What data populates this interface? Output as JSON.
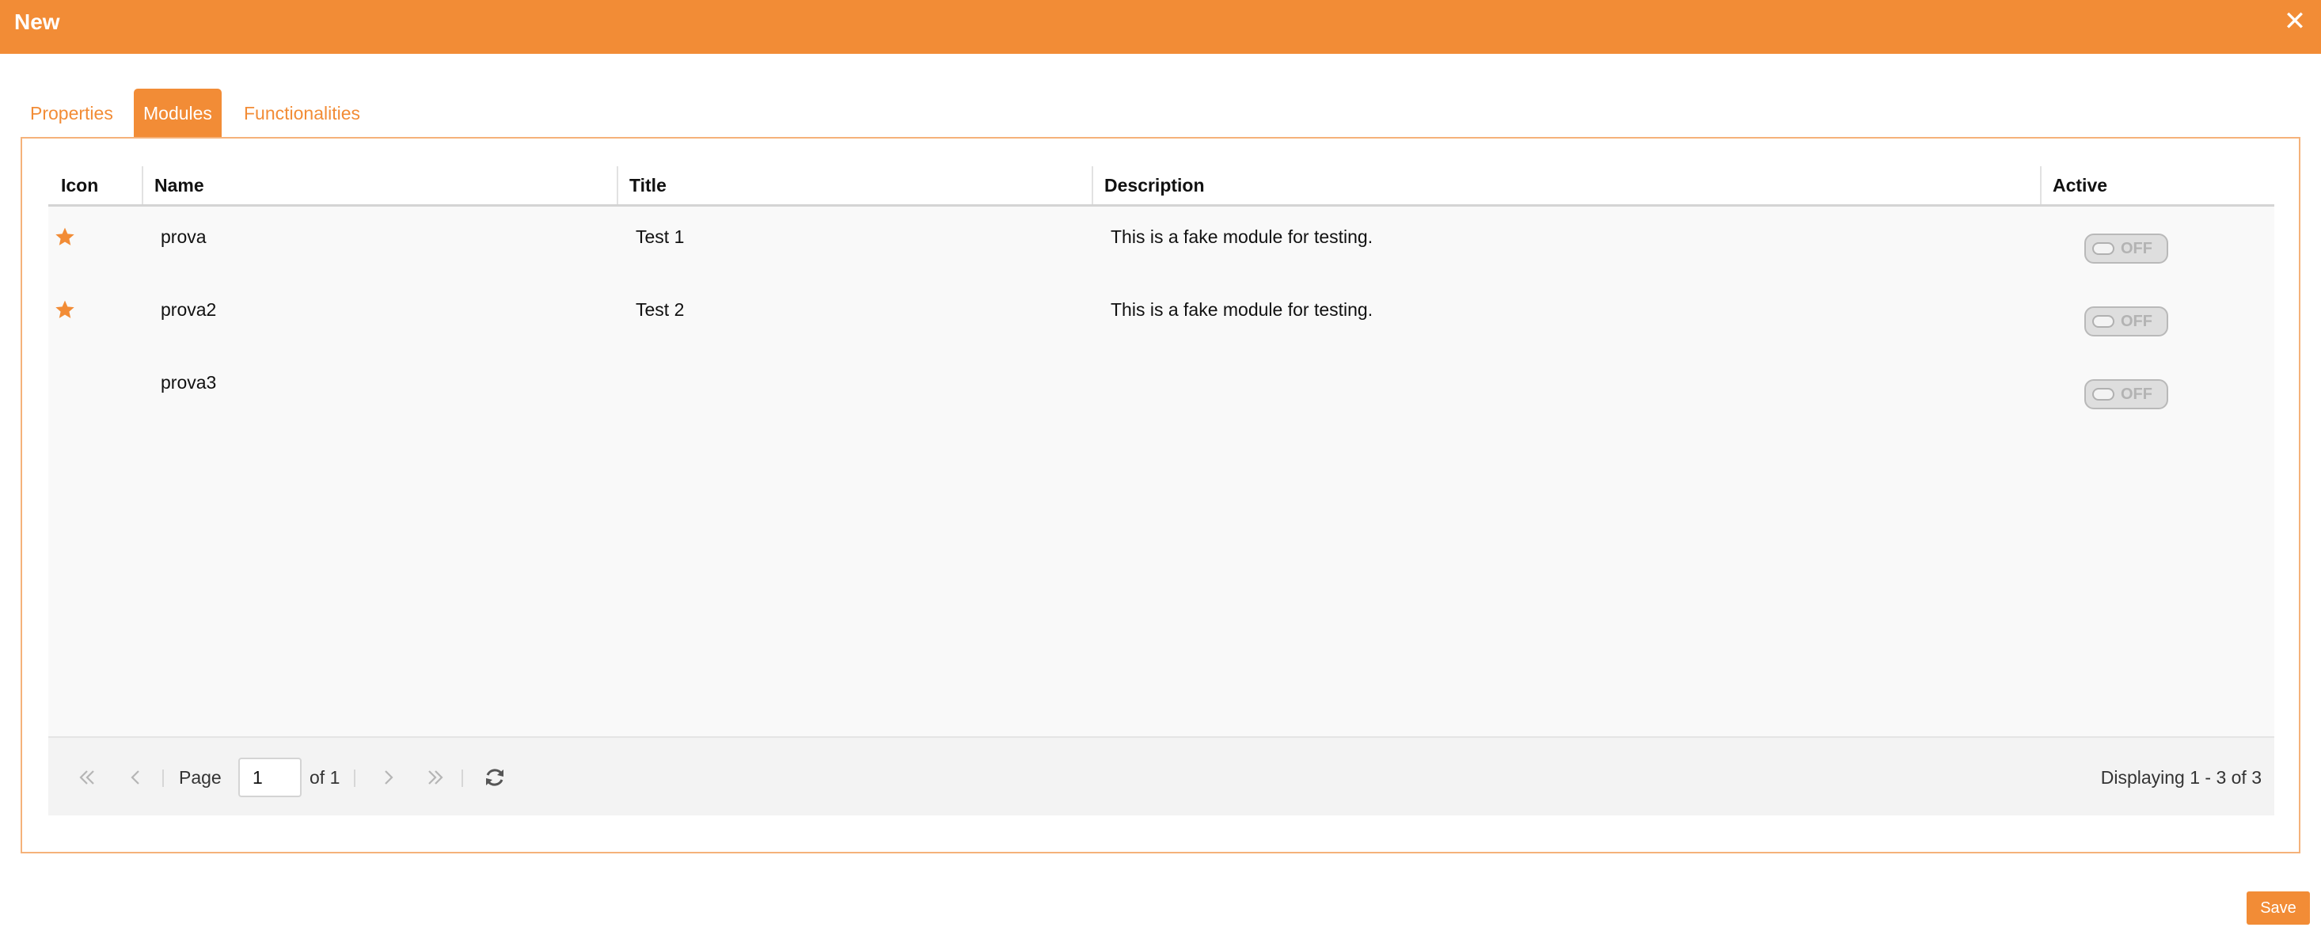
{
  "window": {
    "title": "New",
    "close_icon": "close-icon",
    "accent_color": "#f28c36"
  },
  "tabs": [
    {
      "label": "Properties",
      "active": false
    },
    {
      "label": "Modules",
      "active": true
    },
    {
      "label": "Functionalities",
      "active": false
    }
  ],
  "grid": {
    "columns": [
      "Icon",
      "Name",
      "Title",
      "Description",
      "Active"
    ],
    "rows": [
      {
        "icon": "star-icon",
        "name": "prova",
        "title": "Test 1",
        "description": "This is a fake module for testing.",
        "active": "OFF"
      },
      {
        "icon": "star-icon",
        "name": "prova2",
        "title": "Test 2",
        "description": "This is a fake module for testing.",
        "active": "OFF"
      },
      {
        "icon": "",
        "name": "prova3",
        "title": "",
        "description": "",
        "active": "OFF"
      }
    ]
  },
  "pager": {
    "page_label": "Page",
    "page_value": "1",
    "of_label": "of 1",
    "display_text": "Displaying 1 - 3 of 3",
    "icons": [
      "first-page-icon",
      "prev-page-icon",
      "next-page-icon",
      "last-page-icon",
      "refresh-icon"
    ]
  },
  "footer": {
    "save_label": "Save"
  }
}
